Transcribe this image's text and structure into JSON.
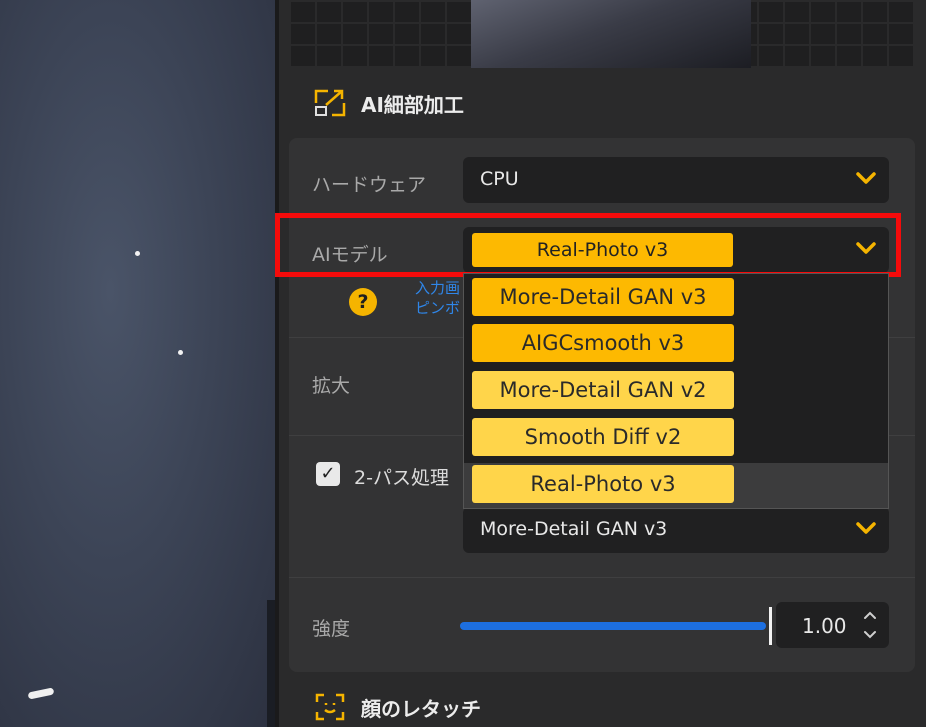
{
  "section_ai_detail": {
    "title": "AI細部加工",
    "icon": "enlarge-icon"
  },
  "hardware": {
    "label": "ハードウェア",
    "value": "CPU"
  },
  "ai_model": {
    "label": "AIモデル",
    "selected": "Real-Photo  v3",
    "options": [
      {
        "label": "More-Detail GAN  v3",
        "color": "#fdb901"
      },
      {
        "label": "AIGCsmooth  v3",
        "color": "#fdb901"
      },
      {
        "label": "More-Detail GAN  v2",
        "color": "#ffd54a"
      },
      {
        "label": "Smooth Diff  v2",
        "color": "#ffd54a"
      },
      {
        "label": "Real-Photo  v3",
        "color": "#ffd54a"
      }
    ]
  },
  "help": {
    "line1": "入力画",
    "line2": "ピンボ"
  },
  "scale": {
    "label": "拡大"
  },
  "two_pass": {
    "label": "2-パス処理",
    "checked": true,
    "model_value": "More-Detail GAN  v3"
  },
  "strength": {
    "label": "強度",
    "value": "1.00",
    "level": 1.0
  },
  "section_face": {
    "title": "顔のレタッチ",
    "icon": "face-scan-icon"
  },
  "colors": {
    "accent": "#f5b400",
    "highlight": "#f50b0b",
    "slider": "#1d6fe0"
  }
}
